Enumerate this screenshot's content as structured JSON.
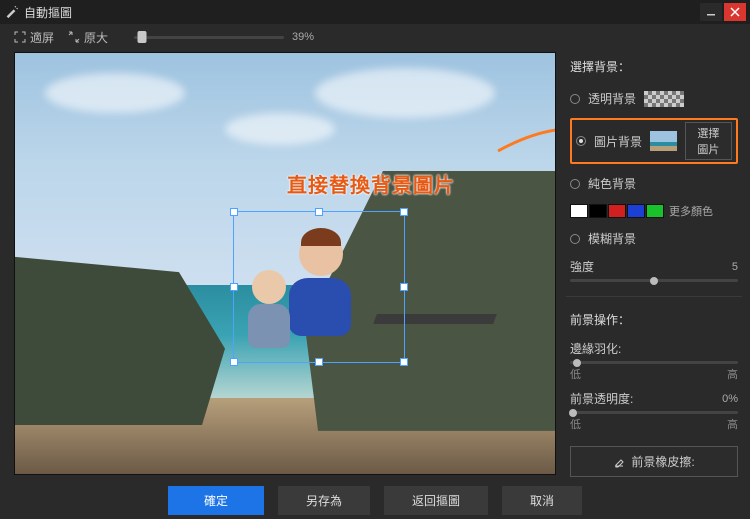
{
  "titlebar": {
    "title": "自動摳圖"
  },
  "toolbar": {
    "fit_label": "適屏",
    "orig_label": "原大",
    "zoom_value": "39%"
  },
  "annotation": {
    "text": "直接替換背景圖片"
  },
  "sidebar": {
    "bg_section_title": "選擇背景：",
    "opt_transparent": "透明背景",
    "opt_image": "圖片背景",
    "choose_image_btn": "選擇圖片",
    "opt_solid": "純色背景",
    "more_colors": "更多顏色",
    "opt_blur": "模糊背景",
    "intensity_label": "強度",
    "intensity_value": "5",
    "fg_section_title": "前景操作：",
    "feather_label": "邊緣羽化:",
    "feather_low": "低",
    "feather_high": "高",
    "opacity_label": "前景透明度:",
    "opacity_value": "0%",
    "opacity_low": "低",
    "opacity_high": "高",
    "eraser_btn": "前景橡皮擦:",
    "swatches": [
      "#ffffff",
      "#000000",
      "#d21f1f",
      "#1c3fd6",
      "#19c22a"
    ]
  },
  "footer": {
    "ok": "確定",
    "save_as": "另存為",
    "back": "返回摳圖",
    "cancel": "取消"
  }
}
